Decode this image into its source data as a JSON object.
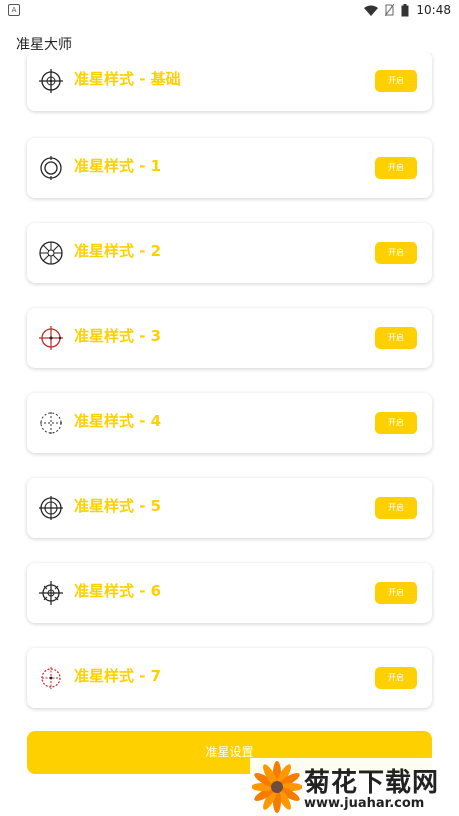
{
  "status_bar": {
    "time": "10:48"
  },
  "app": {
    "title": "准星大师"
  },
  "items": [
    {
      "label": "准星样式 - 基础",
      "button": "开启",
      "icon": "crosshair-basic-icon"
    },
    {
      "label": "准星样式 - 1",
      "button": "开启",
      "icon": "crosshair-rings-icon"
    },
    {
      "label": "准星样式 - 2",
      "button": "开启",
      "icon": "crosshair-spokes-icon"
    },
    {
      "label": "准星样式 - 3",
      "button": "开启",
      "icon": "crosshair-red-icon"
    },
    {
      "label": "准星样式 - 4",
      "button": "开启",
      "icon": "crosshair-dashed-icon"
    },
    {
      "label": "准星样式 - 5",
      "button": "开启",
      "icon": "crosshair-circle-cross-icon"
    },
    {
      "label": "准星样式 - 6",
      "button": "开启",
      "icon": "crosshair-gear-icon"
    },
    {
      "label": "准星样式 - 7",
      "button": "开启",
      "icon": "crosshair-red-dotted-icon"
    }
  ],
  "bottom_button": {
    "label": "准星设置"
  },
  "watermark": {
    "title": "菊花下载网",
    "url": "www.juahar.com"
  },
  "colors": {
    "accent": "#ffd000",
    "crosshair_red": "#c62828"
  }
}
